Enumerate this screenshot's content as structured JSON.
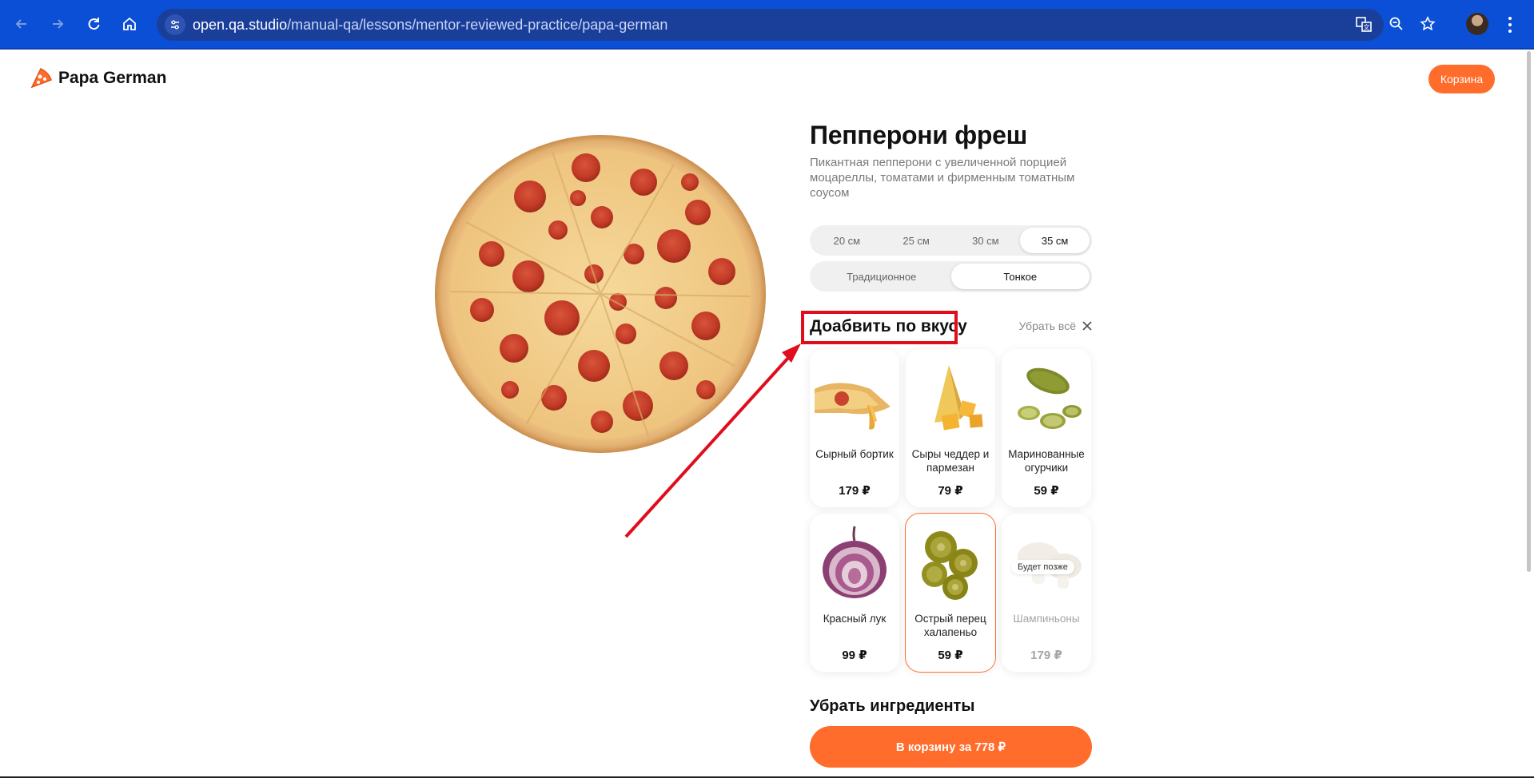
{
  "browser": {
    "url_host": "open.qa.studio",
    "url_path": "/manual-qa/lessons/mentor-reviewed-practice/papa-german",
    "icons": [
      "back-icon",
      "forward-icon",
      "reload-icon",
      "home-icon",
      "site-info-icon",
      "translate-icon",
      "zoom-icon",
      "bookmark-star-icon",
      "profile-avatar",
      "menu-icon"
    ]
  },
  "header": {
    "logo_text": "Papa German",
    "cart_label": "Корзина"
  },
  "product": {
    "title": "Пепперони фреш",
    "description": "Пикантная пепперони с увеличенной порцией моцареллы, томатами и фирменным томатным соусом",
    "sizes": [
      "20 см",
      "25 см",
      "30 см",
      "35 см"
    ],
    "selected_size": "35 см",
    "dough": [
      "Традиционное",
      "Тонкое"
    ],
    "selected_dough": "Тонкое"
  },
  "toppings": {
    "title": "Доабвить по вкусу",
    "remove_all_label": "Убрать всё",
    "items": [
      {
        "name": "Сырный бортик",
        "price": "179 ₽",
        "selected": false,
        "available": true
      },
      {
        "name": "Сыры чеддер и пармезан",
        "price": "79 ₽",
        "selected": false,
        "available": true
      },
      {
        "name": "Маринованные огурчики",
        "price": "59 ₽",
        "selected": false,
        "available": true
      },
      {
        "name": "Красный лук",
        "price": "99 ₽",
        "selected": false,
        "available": true
      },
      {
        "name": "Острый перец халапеньо",
        "price": "59 ₽",
        "selected": true,
        "available": true
      },
      {
        "name": "Шампиньоны",
        "price": "179 ₽",
        "selected": false,
        "available": false,
        "badge": "Будет позже"
      }
    ]
  },
  "remove_ingredients_title": "Убрать ингредиенты",
  "buy_button_label": "В корзину за 778 ₽",
  "colors": {
    "accent": "#ff6c2b",
    "browser_bar": "#0b4fd6",
    "annotation_red": "#e00d1c"
  }
}
